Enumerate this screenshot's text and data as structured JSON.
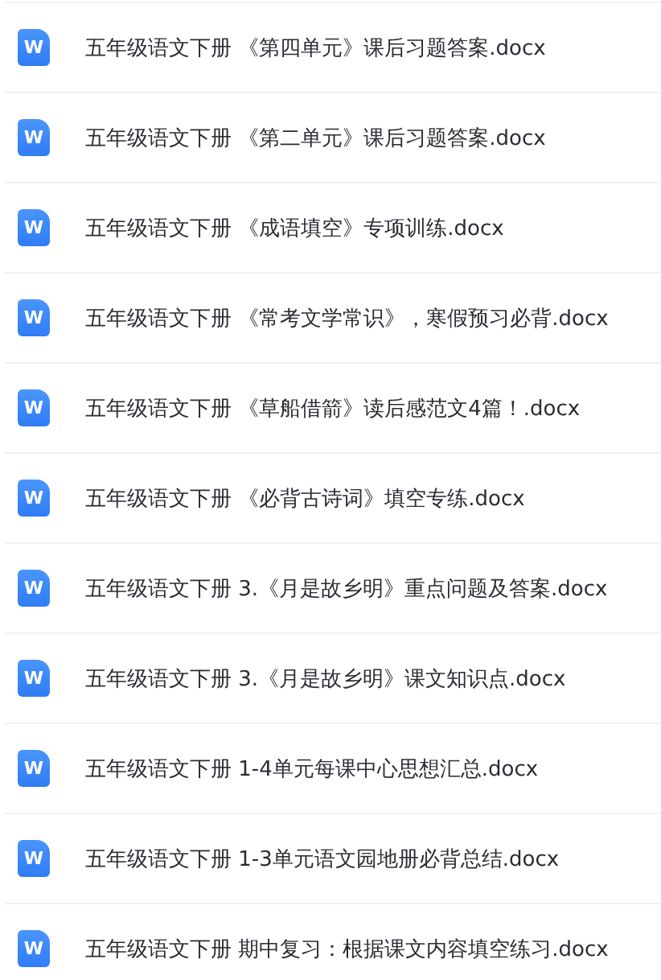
{
  "files": [
    {
      "name": "五年级语文下册 《第四单元》课后习题答案.docx",
      "icon_letter": "W"
    },
    {
      "name": "五年级语文下册 《第二单元》课后习题答案.docx",
      "icon_letter": "W"
    },
    {
      "name": "五年级语文下册 《成语填空》专项训练.docx",
      "icon_letter": "W"
    },
    {
      "name": "五年级语文下册 《常考文学常识》，寒假预习必背.docx",
      "icon_letter": "W"
    },
    {
      "name": "五年级语文下册 《草船借箭》读后感范文4篇！.docx",
      "icon_letter": "W"
    },
    {
      "name": "五年级语文下册 《必背古诗词》填空专练.docx",
      "icon_letter": "W"
    },
    {
      "name": "五年级语文下册 3.《月是故乡明》重点问题及答案.docx",
      "icon_letter": "W"
    },
    {
      "name": "五年级语文下册 3.《月是故乡明》课文知识点.docx",
      "icon_letter": "W"
    },
    {
      "name": "五年级语文下册 1-4单元每课中心思想汇总.docx",
      "icon_letter": "W"
    },
    {
      "name": "五年级语文下册 1-3单元语文园地册必背总结.docx",
      "icon_letter": "W"
    },
    {
      "name": "五年级语文下册 期中复习：根据课文内容填空练习.docx",
      "icon_letter": "W"
    }
  ]
}
